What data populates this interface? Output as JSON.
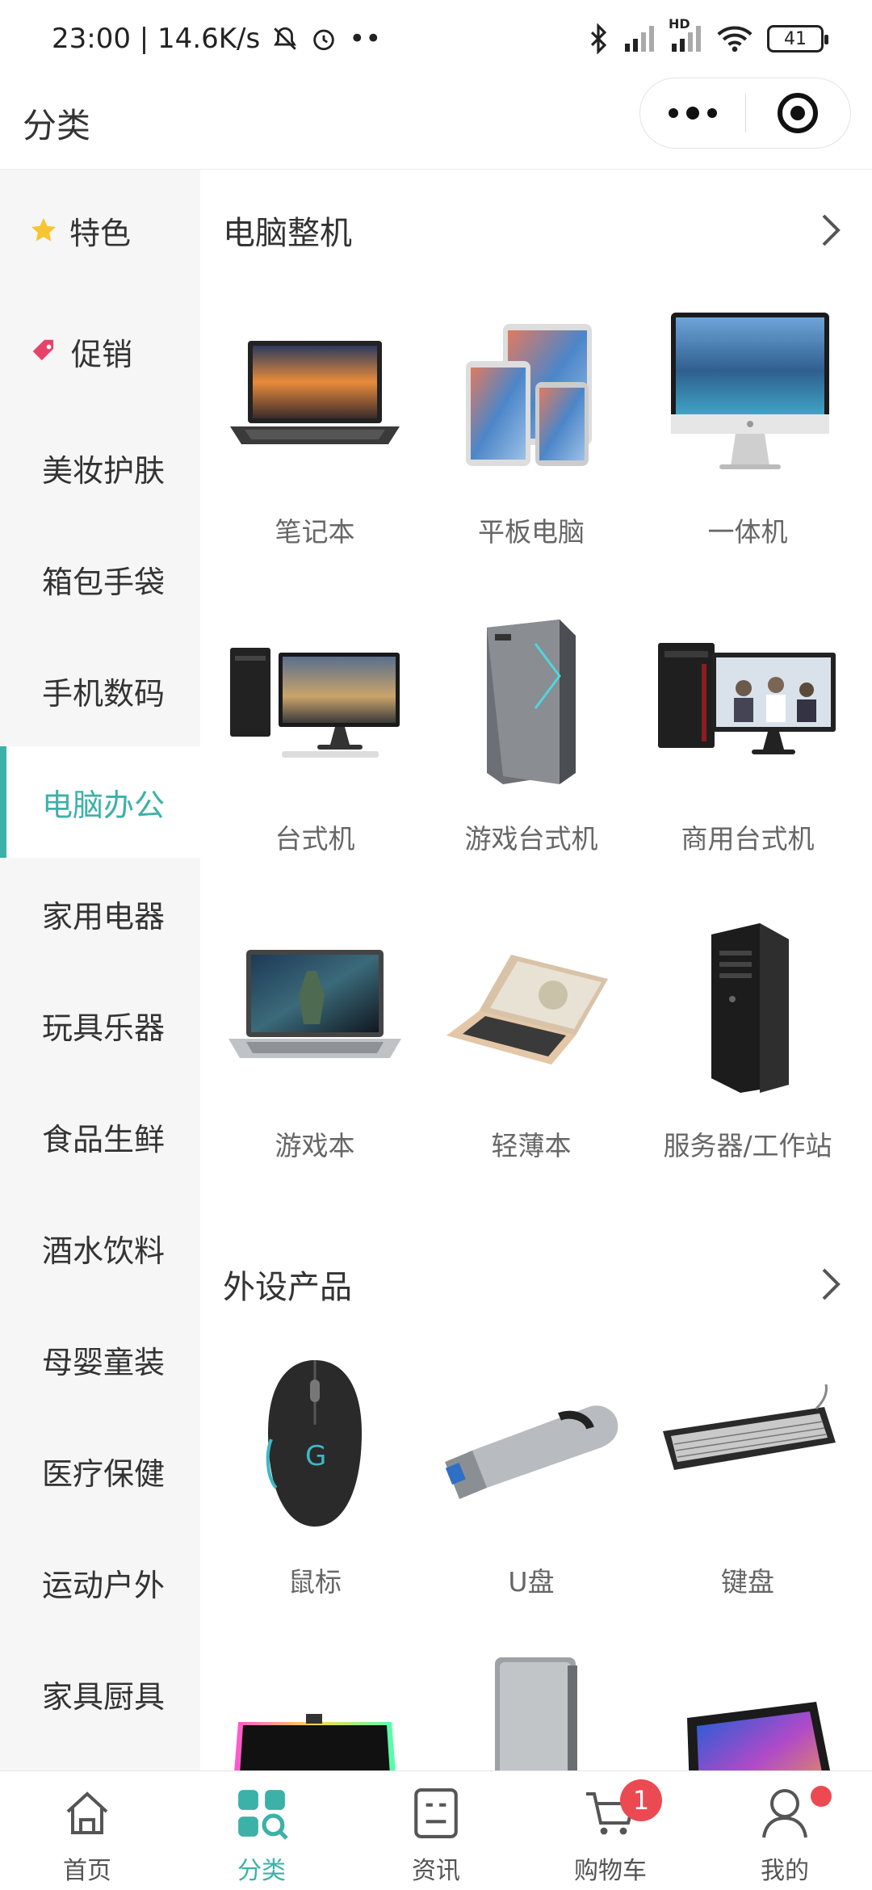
{
  "status_bar": {
    "time_speed": "23:00 | 14.6K/s",
    "hd_label": "HD",
    "battery": "41"
  },
  "header": {
    "title": "分类"
  },
  "sidebar": {
    "items": [
      {
        "label": "特色",
        "icon": "star-icon"
      },
      {
        "label": "促销",
        "icon": "tag-icon"
      },
      {
        "label": "美妆护肤"
      },
      {
        "label": "箱包手袋"
      },
      {
        "label": "手机数码"
      },
      {
        "label": "电脑办公",
        "active": true
      },
      {
        "label": "家用电器"
      },
      {
        "label": "玩具乐器"
      },
      {
        "label": "食品生鲜"
      },
      {
        "label": "酒水饮料"
      },
      {
        "label": "母婴童装"
      },
      {
        "label": "医疗保健"
      },
      {
        "label": "运动户外"
      },
      {
        "label": "家具厨具"
      }
    ]
  },
  "main": {
    "sections": [
      {
        "title": "电脑整机",
        "items": [
          {
            "label": "笔记本",
            "icon": "laptop-image"
          },
          {
            "label": "平板电脑",
            "icon": "tablet-image"
          },
          {
            "label": "一体机",
            "icon": "all-in-one-image"
          },
          {
            "label": "台式机",
            "icon": "desktop-image"
          },
          {
            "label": "游戏台式机",
            "icon": "gaming-desktop-image"
          },
          {
            "label": "商用台式机",
            "icon": "business-desktop-image"
          },
          {
            "label": "游戏本",
            "icon": "gaming-laptop-image"
          },
          {
            "label": "轻薄本",
            "icon": "ultrabook-image"
          },
          {
            "label": "服务器/工作站",
            "icon": "server-image"
          }
        ]
      },
      {
        "title": "外设产品",
        "items": [
          {
            "label": "鼠标",
            "icon": "mouse-image"
          },
          {
            "label": "U盘",
            "icon": "usb-drive-image"
          },
          {
            "label": "键盘",
            "icon": "keyboard-image"
          },
          {
            "label": "",
            "icon": "mousepad-image"
          },
          {
            "label": "",
            "icon": "hard-drive-image"
          },
          {
            "label": "",
            "icon": "drawing-tablet-image"
          }
        ]
      }
    ]
  },
  "tabbar": {
    "items": [
      {
        "label": "首页",
        "icon": "home-icon"
      },
      {
        "label": "分类",
        "icon": "category-icon",
        "active": true
      },
      {
        "label": "资讯",
        "icon": "news-icon"
      },
      {
        "label": "购物车",
        "icon": "cart-icon",
        "badge": "1"
      },
      {
        "label": "我的",
        "icon": "profile-icon",
        "dot": true
      }
    ]
  },
  "colors": {
    "accent": "#3cb1a7",
    "badge": "#ec4a52",
    "sidebar_bg": "#f6f6f6"
  }
}
